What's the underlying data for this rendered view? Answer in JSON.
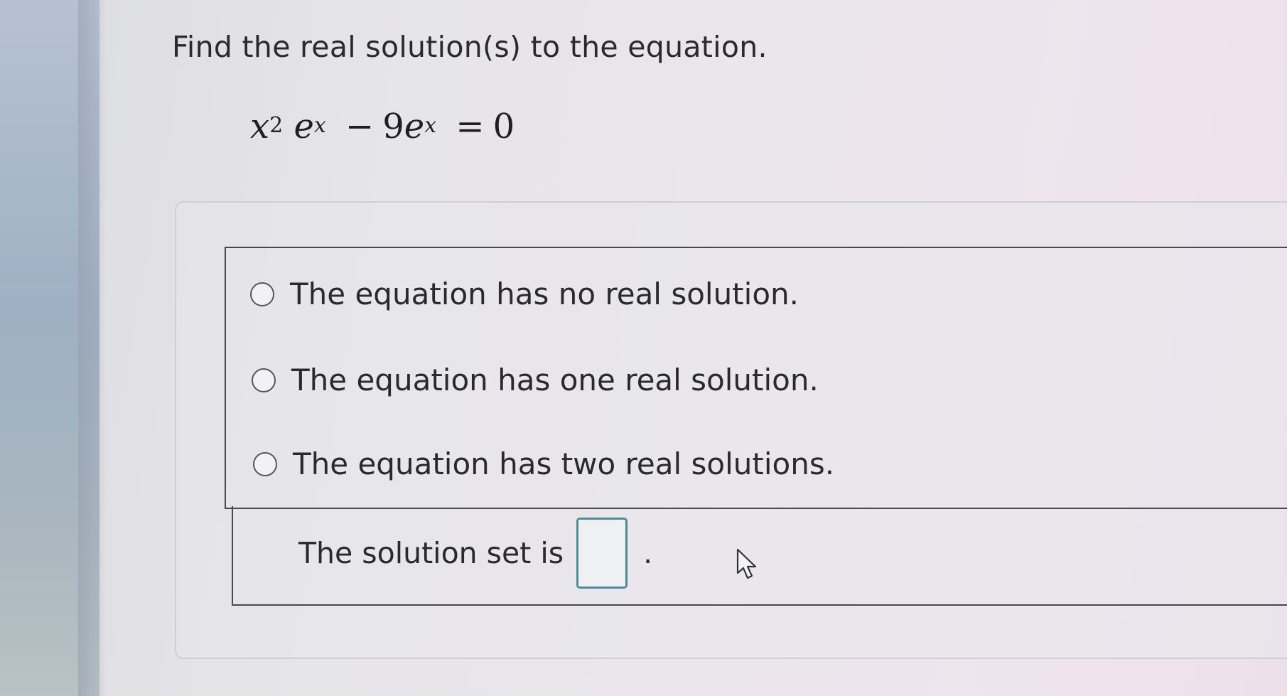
{
  "question": {
    "prompt": "Find the real solution(s) to the equation."
  },
  "equation": {
    "x1": "x",
    "exp2": "2",
    "e1": "e",
    "exp_x1": "x",
    "minus": "−",
    "coef": "9",
    "e2": "e",
    "exp_x2": "x",
    "equals": "=",
    "rhs": "0"
  },
  "choices": [
    {
      "label": "The equation has no real solution."
    },
    {
      "label": "The equation has one real solution."
    },
    {
      "label": "The equation has two real solutions."
    }
  ],
  "answer": {
    "prefix": "The solution set is",
    "value": "",
    "suffix": "."
  },
  "icons": {
    "radio": "radio-button-unselected",
    "cursor": "mouse-pointer-arrow"
  },
  "colors": {
    "input_border": "#4f8b99",
    "text": "#2a2a2c"
  }
}
